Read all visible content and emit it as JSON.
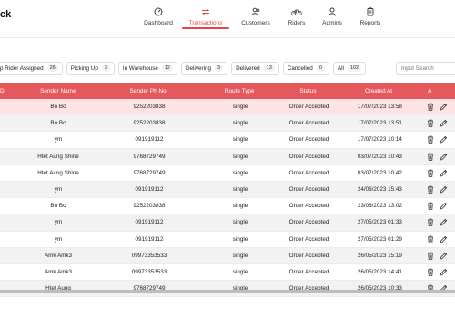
{
  "brand": "ck",
  "nav": [
    {
      "label": "Dashboard",
      "icon": "dashboard-icon",
      "active": false
    },
    {
      "label": "Transactions",
      "icon": "transactions-icon",
      "active": true
    },
    {
      "label": "Customers",
      "icon": "customers-icon",
      "active": false
    },
    {
      "label": "Riders",
      "icon": "bicycle-icon",
      "active": false
    },
    {
      "label": "Admins",
      "icon": "admin-icon",
      "active": false
    },
    {
      "label": "Reports",
      "icon": "reports-icon",
      "active": false
    }
  ],
  "filters": [
    {
      "label": "p Rider Assigned",
      "count": "26"
    },
    {
      "label": "Picking Up",
      "count": "3"
    },
    {
      "label": "In Warehouse",
      "count": "12"
    },
    {
      "label": "Delivering",
      "count": "3"
    },
    {
      "label": "Delivered",
      "count": "13"
    },
    {
      "label": "Cancelled",
      "count": "0"
    },
    {
      "label": "All",
      "count": "102"
    }
  ],
  "search": {
    "placeholder": "Input Search"
  },
  "table": {
    "headers": {
      "id": "D",
      "sender_name": "Sender Name",
      "sender_phone": "Sender Ph No.",
      "route_type": "Route Type",
      "status": "Status",
      "created_at": "Created At",
      "actions": "A"
    },
    "rows": [
      {
        "name": "Bo Bo",
        "phone": "9252203838",
        "route": "single",
        "status": "Order Accepted",
        "created": "17/07/2023 13:58"
      },
      {
        "name": "Bo Bo",
        "phone": "9252203838",
        "route": "single",
        "status": "Order Accepted",
        "created": "17/07/2023 13:51"
      },
      {
        "name": "ym",
        "phone": "091919112",
        "route": "single",
        "status": "Order Accepted",
        "created": "17/07/2023 10:14"
      },
      {
        "name": "Htet Aung Shine",
        "phone": "9768729749",
        "route": "single",
        "status": "Order Accepted",
        "created": "03/07/2023 10:43"
      },
      {
        "name": "Htet Aung Shine",
        "phone": "9768729749",
        "route": "single",
        "status": "Order Accepted",
        "created": "03/07/2023 10:42"
      },
      {
        "name": "ym",
        "phone": "091919112",
        "route": "single",
        "status": "Order Accepted",
        "created": "24/06/2023 15:43"
      },
      {
        "name": "Bo Bo",
        "phone": "9252203838",
        "route": "single",
        "status": "Order Accepted",
        "created": "23/06/2023 13:02"
      },
      {
        "name": "ym",
        "phone": "091919112",
        "route": "single",
        "status": "Order Accepted",
        "created": "27/05/2023 01:33"
      },
      {
        "name": "ym",
        "phone": "091919112",
        "route": "single",
        "status": "Order Accepted",
        "created": "27/05/2023 01:29"
      },
      {
        "name": "Amk Amk3",
        "phone": "09973353533",
        "route": "single",
        "status": "Order Accepted",
        "created": "26/05/2023 15:19"
      },
      {
        "name": "Amk Amk3",
        "phone": "09973353533",
        "route": "single",
        "status": "Order Accepted",
        "created": "26/05/2023 14:41"
      },
      {
        "name": "Htet Aung",
        "phone": "9768729749",
        "route": "single",
        "status": "Order Accepted",
        "created": "26/05/2023 10:33"
      }
    ]
  },
  "colors": {
    "accent": "#e0464a",
    "header_bg": "#e5585c",
    "highlight_row": "#fde3e3"
  }
}
